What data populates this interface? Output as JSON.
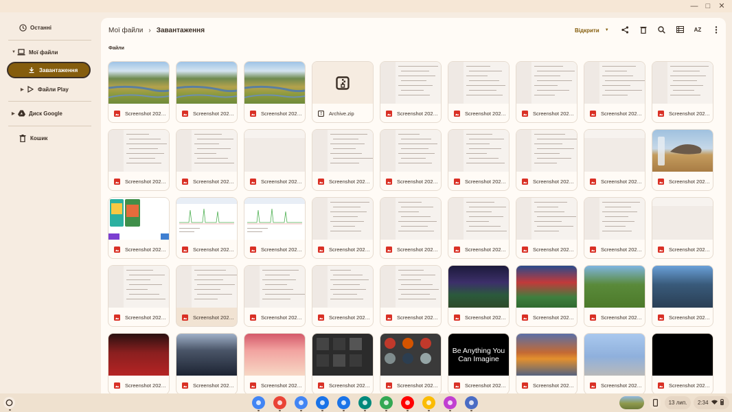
{
  "window": {
    "controls": [
      "minimize",
      "maximize",
      "close"
    ]
  },
  "sidebar": {
    "items": [
      {
        "label": "Останні",
        "icon": "clock-icon"
      },
      {
        "label": "Мої файли",
        "icon": "laptop-icon"
      },
      {
        "label": "Завантаження",
        "icon": "download-icon"
      },
      {
        "label": "Файли Play",
        "icon": "play-icon"
      },
      {
        "label": "Диск Google",
        "icon": "drive-icon"
      },
      {
        "label": "Кошик",
        "icon": "trash-icon"
      }
    ]
  },
  "header": {
    "breadcrumb": [
      "Мої файли",
      "Завантаження"
    ],
    "open_label": "Відкрити",
    "sort_label": "AZ",
    "toolbar_icons": [
      "share-icon",
      "delete-icon",
      "search-icon",
      "list-view-icon",
      "sort-icon",
      "more-icon"
    ]
  },
  "section_label": "Файли",
  "files": [
    {
      "name": "Screenshot 202…",
      "thumb": "field"
    },
    {
      "name": "Screenshot 202…",
      "thumb": "field"
    },
    {
      "name": "Screenshot 202…",
      "thumb": "field"
    },
    {
      "name": "Archive.zip",
      "thumb": "zip"
    },
    {
      "name": "Screenshot 202…",
      "thumb": "doc"
    },
    {
      "name": "Screenshot 202…",
      "thumb": "doc"
    },
    {
      "name": "Screenshot 202…",
      "thumb": "doc"
    },
    {
      "name": "Screenshot 202…",
      "thumb": "doc"
    },
    {
      "name": "Screenshot 202…",
      "thumb": "doc"
    },
    {
      "name": "Screenshot 202…",
      "thumb": "doc"
    },
    {
      "name": "Screenshot 202…",
      "thumb": "doc"
    },
    {
      "name": "Screenshot 202…",
      "thumb": "blank"
    },
    {
      "name": "Screenshot 202…",
      "thumb": "doc"
    },
    {
      "name": "Screenshot 202…",
      "thumb": "doc"
    },
    {
      "name": "Screenshot 202…",
      "thumb": "doc"
    },
    {
      "name": "Screenshot 202…",
      "thumb": "doc"
    },
    {
      "name": "Screenshot 202…",
      "thumb": "blank"
    },
    {
      "name": "Screenshot 202…",
      "thumb": "rock"
    },
    {
      "name": "Screenshot 202…",
      "thumb": "apps"
    },
    {
      "name": "Screenshot 202…",
      "thumb": "graph"
    },
    {
      "name": "Screenshot 202…",
      "thumb": "graph"
    },
    {
      "name": "Screenshot 202…",
      "thumb": "doc"
    },
    {
      "name": "Screenshot 202…",
      "thumb": "doc"
    },
    {
      "name": "Screenshot 202…",
      "thumb": "doc"
    },
    {
      "name": "Screenshot 202…",
      "thumb": "doc"
    },
    {
      "name": "Screenshot 202…",
      "thumb": "doc"
    },
    {
      "name": "Screenshot 202…",
      "thumb": "blank"
    },
    {
      "name": "Screenshot 202…",
      "thumb": "doc"
    },
    {
      "name": "Screenshot 202…",
      "thumb": "doc",
      "selected": true
    },
    {
      "name": "Screenshot 202…",
      "thumb": "doc"
    },
    {
      "name": "Screenshot 202…",
      "thumb": "doc"
    },
    {
      "name": "Screenshot 202…",
      "thumb": "doc"
    },
    {
      "name": "Screenshot 202…",
      "thumb": "game1"
    },
    {
      "name": "Screenshot 202…",
      "thumb": "game2"
    },
    {
      "name": "Screenshot 202…",
      "thumb": "game3"
    },
    {
      "name": "Screenshot 202…",
      "thumb": "game4"
    },
    {
      "name": "Screenshot 202…",
      "thumb": "red"
    },
    {
      "name": "Screenshot 202…",
      "thumb": "arena"
    },
    {
      "name": "Screenshot 202…",
      "thumb": "pink"
    },
    {
      "name": "Screenshot 202…",
      "thumb": "dark"
    },
    {
      "name": "Screenshot 202…",
      "thumb": "avatar"
    },
    {
      "name": "Screenshot 202…",
      "thumb": "text",
      "thumb_text": "Be Anything You Can Imagine"
    },
    {
      "name": "Screenshot 202…",
      "thumb": "fire"
    },
    {
      "name": "Screenshot 202…",
      "thumb": "blocks"
    },
    {
      "name": "Screenshot 202…",
      "thumb": "black"
    }
  ],
  "shelf": {
    "apps": [
      {
        "name": "chrome-icon",
        "color": "#4285f4"
      },
      {
        "name": "gmail-icon",
        "color": "#ea4335"
      },
      {
        "name": "docs-icon",
        "color": "#4285f4"
      },
      {
        "name": "files-icon",
        "color": "#1a73e8"
      },
      {
        "name": "messages-icon",
        "color": "#1a73e8"
      },
      {
        "name": "meet-icon",
        "color": "#00897b"
      },
      {
        "name": "play-store-icon",
        "color": "#34a853"
      },
      {
        "name": "youtube-icon",
        "color": "#ff0000"
      },
      {
        "name": "photos-icon",
        "color": "#fbbc04"
      },
      {
        "name": "app-icon",
        "color": "#c13fd1"
      },
      {
        "name": "app2-icon",
        "color": "#4a6cc4"
      }
    ],
    "date": "13 лип.",
    "time": "2:34"
  },
  "colors": {
    "accent": "#855d0d",
    "background": "#f6ece1",
    "panel": "#fffbf6"
  }
}
